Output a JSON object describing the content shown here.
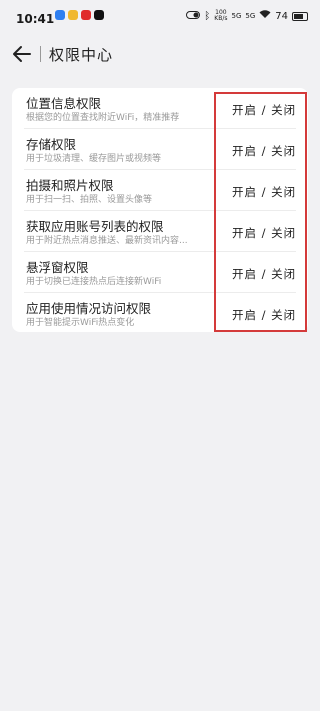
{
  "status_bar": {
    "time": "10:41",
    "network_top": "100",
    "network_bottom": "KB/s",
    "signal_1": "5G",
    "signal_2": "5G",
    "battery": "74",
    "battery_percent": 0.74
  },
  "header": {
    "title": "权限中心",
    "back_icon": "arrow-left-icon"
  },
  "permissions": [
    {
      "title": "位置信息权限",
      "desc": "根据您的位置查找附近WiFi，精准推荐",
      "status": "开启 / 关闭"
    },
    {
      "title": "存储权限",
      "desc": "用于垃圾清理、缓存图片或视频等",
      "status": "开启 / 关闭"
    },
    {
      "title": "拍摄和照片权限",
      "desc": "用于扫一扫、拍照、设置头像等",
      "status": "开启 / 关闭"
    },
    {
      "title": "获取应用账号列表的权限",
      "desc": "用于附近热点消息推送、最新资讯内容...",
      "status": "开启 / 关闭"
    },
    {
      "title": "悬浮窗权限",
      "desc": "用于切换已连接热点后连接新WiFi",
      "status": "开启 / 关闭"
    },
    {
      "title": "应用使用情况访问权限",
      "desc": "用于智能提示WiFi热点变化",
      "status": "开启 / 关闭"
    }
  ],
  "colors": {
    "highlight": "#d43a3a",
    "background": "#f1f1f3"
  }
}
